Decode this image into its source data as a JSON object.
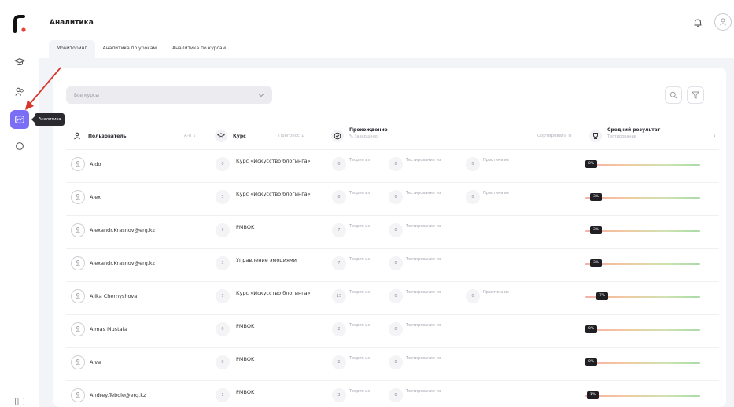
{
  "sidebar": {
    "tooltip": "Аналитика"
  },
  "header": {
    "title": "Аналитика",
    "tabs": [
      "Мониторинг",
      "Аналитика по урокам",
      "Аналитика по курсам"
    ]
  },
  "filters": {
    "course_select": "Все курсы"
  },
  "table": {
    "col_user": "Пользователь",
    "col_user_sort": "А-я ↓",
    "col_course": "Курс",
    "col_course_sort": "Прогресс ↓",
    "col_progress": "Прохождение",
    "col_progress_sub": "% Завершено",
    "col_progress_sort": "Сортировать ≡",
    "col_result": "Средний результат",
    "col_result_sub": "Тестирование",
    "col_result_sort": "↓",
    "rows": [
      {
        "name": "Aldo",
        "course_num": "0",
        "course": "Курс «Искусство блогинга»",
        "s1_num": "0",
        "s1": "Теория из",
        "s2_num": "0",
        "s2": "Тестирование из",
        "s3_num": "0",
        "s3": "Практика из",
        "pct": "0%",
        "pct_value": 0
      },
      {
        "name": "Alex",
        "course_num": "3",
        "course": "Курс «Искусство блогинга»",
        "s1_num": "8",
        "s1": "Теория из",
        "s2_num": "0",
        "s2": "Тестирование из",
        "s3_num": "0",
        "s3": "Практика из",
        "pct": "3%",
        "pct_value": 3
      },
      {
        "name": "Alexandr.Krasnov@erg.kz",
        "course_num": "9",
        "course": "PMBOK",
        "s1_num": "7",
        "s1": "Теория из",
        "s2_num": "0",
        "s2": "Тестирование из",
        "s3_num": "",
        "s3": "",
        "pct": "3%",
        "pct_value": 3
      },
      {
        "name": "Alexandr.Krasnov@erg.kz",
        "course_num": "3",
        "course": "Управление эмоциями",
        "s1_num": "7",
        "s1": "Теория из",
        "s2_num": "0",
        "s2": "Тестирование из",
        "s3_num": "",
        "s3": "",
        "pct": "3%",
        "pct_value": 3
      },
      {
        "name": "Alika Chernyshova",
        "course_num": "7",
        "course": "Курс «Искусство блогинга»",
        "s1_num": "15",
        "s1": "Теория из",
        "s2_num": "0",
        "s2": "Тестирование из",
        "s3_num": "0",
        "s3": "Практика из",
        "pct": "7%",
        "pct_value": 7
      },
      {
        "name": "Almas Mustafa",
        "course_num": "0",
        "course": "PMBOK",
        "s1_num": "2",
        "s1": "Теория из",
        "s2_num": "0",
        "s2": "Тестирование из",
        "s3_num": "",
        "s3": "",
        "pct": "0%",
        "pct_value": 0
      },
      {
        "name": "Alva",
        "course_num": "0",
        "course": "PMBOK",
        "s1_num": "2",
        "s1": "Теория из",
        "s2_num": "0",
        "s2": "Тестирование из",
        "s3_num": "",
        "s3": "",
        "pct": "0%",
        "pct_value": 0
      },
      {
        "name": "Andrey.Tebole@erg.kz",
        "course_num": "1",
        "course": "PMBOK",
        "s1_num": "3",
        "s1": "Теория из",
        "s2_num": "0",
        "s2": "Тестирование из",
        "s3_num": "",
        "s3": "",
        "pct": "1%",
        "pct_value": 1
      }
    ]
  },
  "colors": {
    "accent": "#7b6ef6",
    "tooltip_bg": "#2b2b2f",
    "arrow": "#d9352b"
  }
}
